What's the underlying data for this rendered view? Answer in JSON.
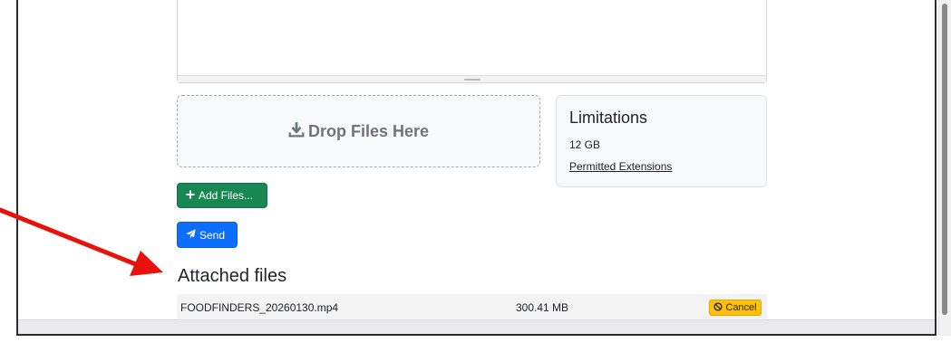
{
  "upload": {
    "dropzone_label": "Drop Files Here",
    "add_files_label": "Add Files...",
    "send_label": "Send"
  },
  "limitations": {
    "title": "Limitations",
    "max_size": "12 GB",
    "extensions_link": "Permitted Extensions"
  },
  "attached": {
    "title": "Attached files",
    "files": [
      {
        "name": "FOODFINDERS_20260130.mp4",
        "size": "300.41 MB",
        "cancel_label": "Cancel"
      }
    ]
  },
  "colors": {
    "add_button": "#198754",
    "send_button": "#0d6efd",
    "cancel_button": "#ffc107",
    "annotation_arrow": "#e8120c"
  },
  "icons": {
    "dropzone": "download-icon",
    "add": "plus-icon",
    "send": "paper-plane-icon",
    "cancel": "ban-icon"
  }
}
